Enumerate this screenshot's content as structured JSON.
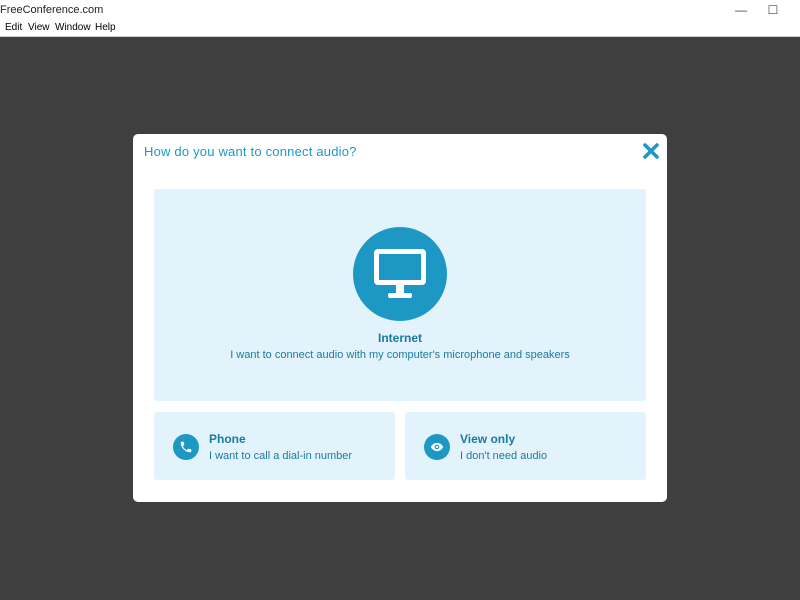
{
  "window": {
    "title": "FreeConference.com",
    "minimize_glyph": "—",
    "maximize_glyph": "☐"
  },
  "menu": {
    "items": [
      "Edit",
      "View",
      "Window",
      "Help"
    ]
  },
  "dialog": {
    "title": "How do you want to connect audio?",
    "close_icon": "close-x-icon",
    "options": {
      "internet": {
        "label": "Internet",
        "description": "I want to connect audio with my computer's microphone and speakers",
        "icon": "monitor-icon"
      },
      "phone": {
        "label": "Phone",
        "description": "I want to call a dial-in number",
        "icon": "phone-icon"
      },
      "view_only": {
        "label": "View only",
        "description": "I don't need audio",
        "icon": "eye-icon"
      }
    }
  },
  "colors": {
    "accent": "#1d98c5",
    "option_bg": "#e2f3fb",
    "backdrop": "#3f3f3f",
    "text_accent": "#1c7aa0"
  }
}
